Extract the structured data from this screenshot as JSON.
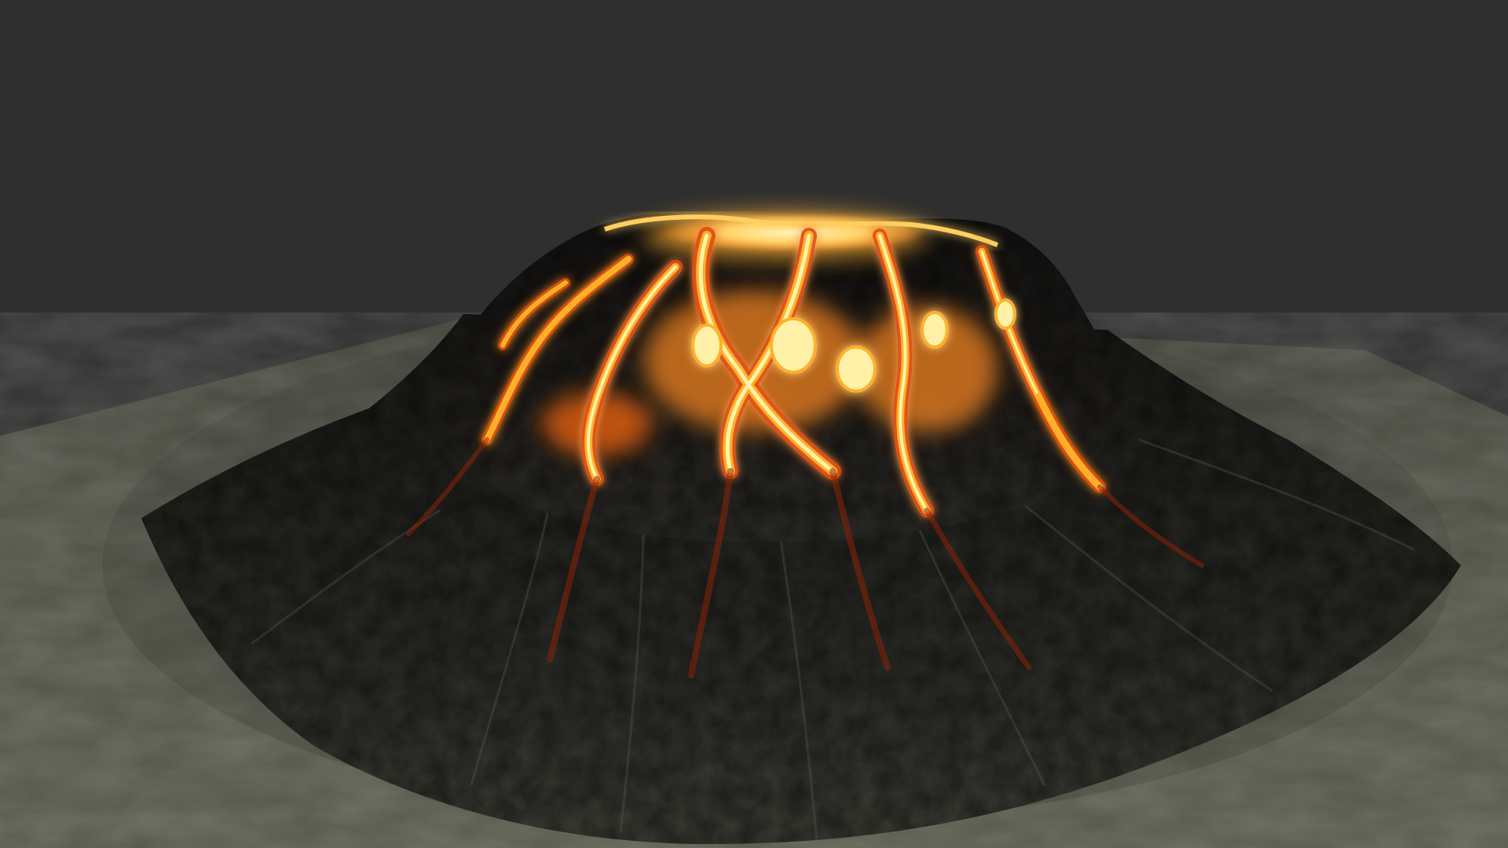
{
  "scene": {
    "subject": "volcano",
    "background_color": "#2f2f2f",
    "ground_color": "#4f5245",
    "ground_shadow_color": "#3a3d33",
    "rock_color": "#1d1b19",
    "rock_highlight_color": "#4a4640",
    "lava_core_color": "#fff2a8",
    "lava_mid_color": "#ffb02a",
    "lava_edge_color": "#e04a10",
    "lava_dark_color": "#8a2208"
  }
}
